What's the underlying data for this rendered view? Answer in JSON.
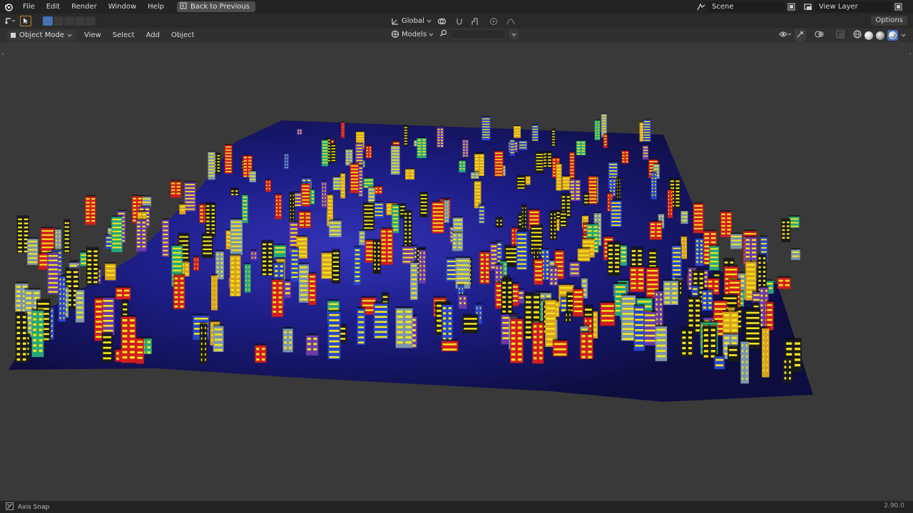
{
  "topbar": {
    "menus": [
      "File",
      "Edit",
      "Render",
      "Window",
      "Help"
    ],
    "back_button": "Back to Previous",
    "scene": "Scene",
    "view_layer": "View Layer"
  },
  "toolheader": {
    "orientation": "Global",
    "options": "Options"
  },
  "viewport_header": {
    "mode": "Object Mode",
    "menus": [
      "View",
      "Select",
      "Add",
      "Object"
    ],
    "collection": "Models",
    "search_placeholder": ""
  },
  "statusbar": {
    "hint": "Axis Snap",
    "version": "2.90.0"
  },
  "colors": {
    "accent": "#4772b3",
    "ground": "#1a1a6e",
    "window_yellow": "#f5e51b",
    "building_red": "#d11d1d",
    "building_teal": "#27a878",
    "building_gray": "#7d96a8",
    "building_blue": "#2847c9",
    "building_purple": "#6b3aa8"
  },
  "icons": [
    "blender-logo-icon",
    "back-arrow-icon",
    "scene-icon",
    "view-layer-icon",
    "orientation-icon",
    "snap-icon",
    "proportional-icon",
    "search-icon",
    "overlay-icon",
    "gizmo-icon",
    "xray-icon",
    "shading-solid-icon",
    "shading-material-icon",
    "shading-rendered-icon"
  ]
}
